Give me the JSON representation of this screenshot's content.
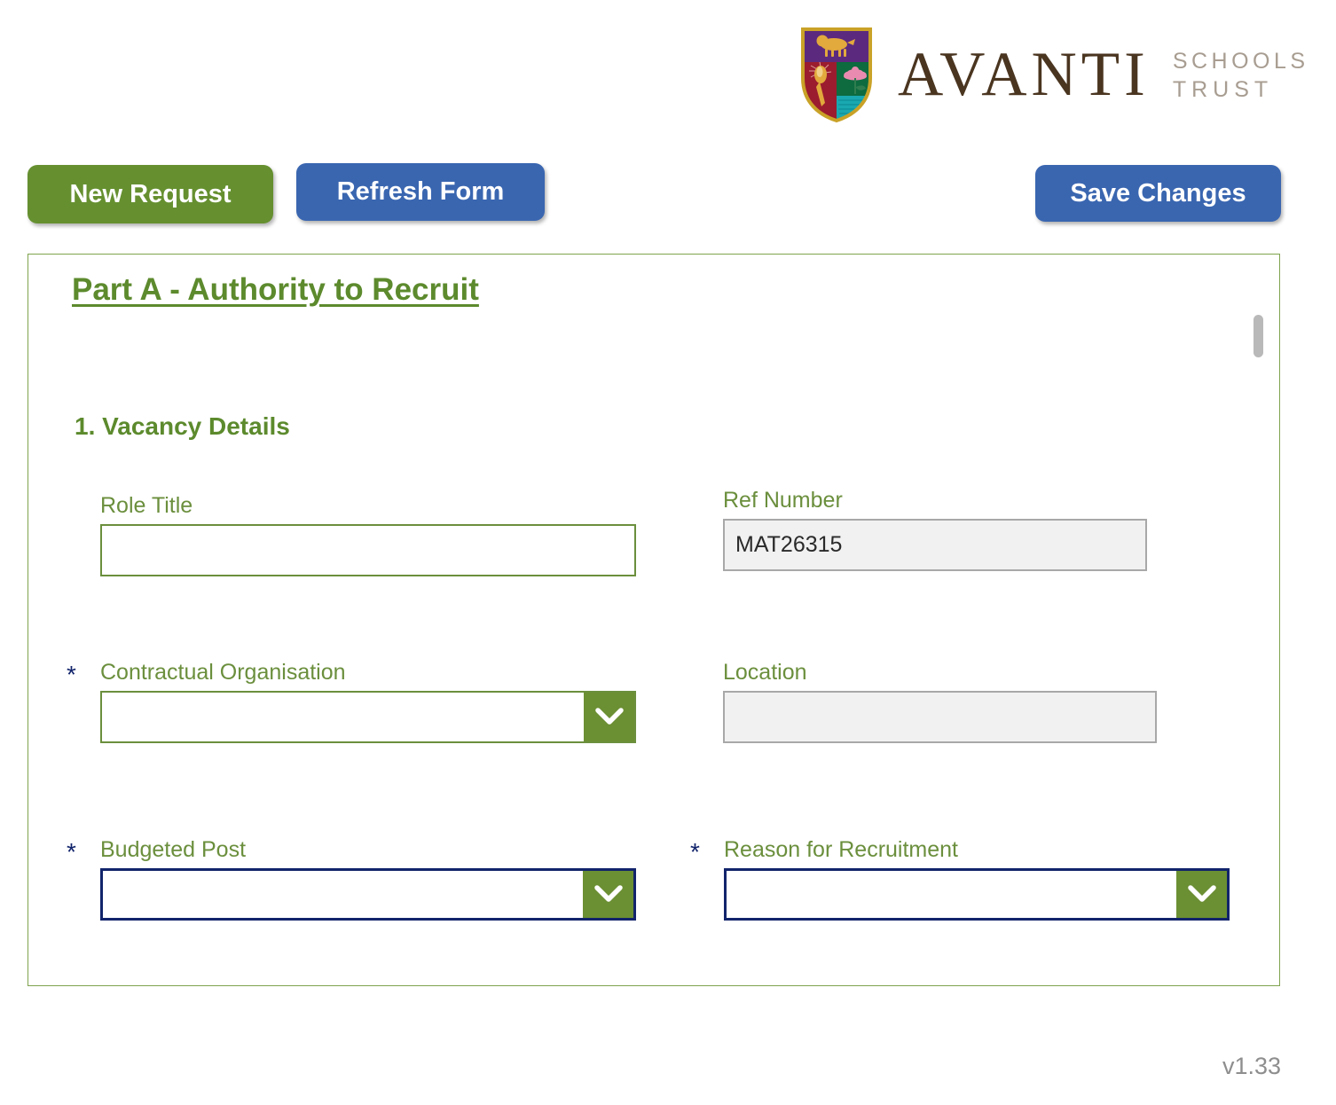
{
  "brand": {
    "crest_icon": "avanti-crest-icon",
    "name": "AVANTI",
    "sub_line1": "SCHOOLS",
    "sub_line2": "TRUST",
    "colors": {
      "crest_border": "#c9a227",
      "crest_purple": "#5b2a7e",
      "crest_red": "#9b1c2e",
      "crest_green": "#0d6b3f",
      "crest_teal": "#1aa8b0",
      "wordmark": "#4a3520",
      "subtext": "#a89d91"
    }
  },
  "toolbar": {
    "new_request_label": "New Request",
    "refresh_form_label": "Refresh Form",
    "save_changes_label": "Save Changes",
    "colors": {
      "green": "#669030",
      "blue": "#3a66b0"
    }
  },
  "form": {
    "part_title": "Part A - Authority to Recruit",
    "section_title": "1. Vacancy Details",
    "required_marker": "*",
    "colors": {
      "heading_green": "#5c8a2d",
      "label_green": "#6b8f3d",
      "border_green": "#6b8f3d",
      "border_navy": "#12246b",
      "readonly_bg": "#f1f1f1",
      "readonly_border": "#a8a8a8",
      "arrow_green": "#6b8f33"
    },
    "fields": {
      "role_title": {
        "label": "Role Title",
        "value": "",
        "placeholder": ""
      },
      "ref_number": {
        "label": "Ref Number",
        "value": "MAT26315",
        "placeholder": ""
      },
      "contractual_organisation": {
        "label": "Contractual Organisation",
        "value": "",
        "required_marker": "*",
        "dropdown_icon": "chevron-down-icon"
      },
      "location": {
        "label": "Location",
        "value": "",
        "placeholder": ""
      },
      "budgeted_post": {
        "label": "Budgeted Post",
        "value": "",
        "required_marker": "*",
        "dropdown_icon": "chevron-down-icon"
      },
      "reason_for_recruitment": {
        "label": "Reason for Recruitment",
        "value": "",
        "required_marker": "*",
        "dropdown_icon": "chevron-down-icon"
      }
    }
  },
  "footer": {
    "version": "v1.33"
  }
}
